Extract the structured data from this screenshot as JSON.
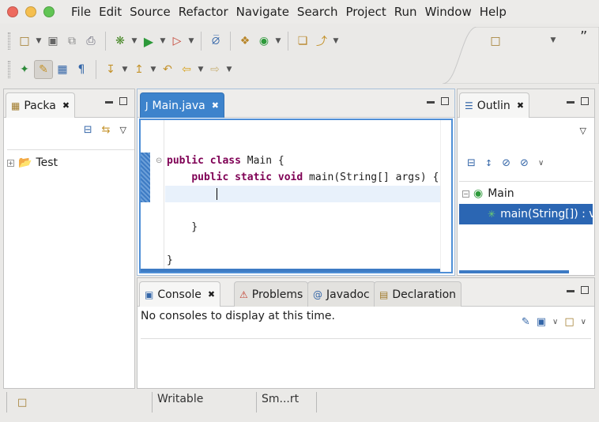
{
  "window": {
    "buttons": [
      {
        "name": "close",
        "color": "#ed6a5e"
      },
      {
        "name": "minimize",
        "color": "#f5bf4f"
      },
      {
        "name": "maximize",
        "color": "#61c554"
      }
    ]
  },
  "menu": [
    "File",
    "Edit",
    "Source",
    "Refactor",
    "Navigate",
    "Search",
    "Project",
    "Run",
    "Window",
    "Help"
  ],
  "toolbar": {
    "overflow_label": "”"
  },
  "package_explorer": {
    "tab_label": "Packa",
    "tree": [
      {
        "label": "Test",
        "expanded": false
      }
    ]
  },
  "editor": {
    "tab_label": "Main.java",
    "code": {
      "line2": {
        "kw1": "public",
        "kw2": "class",
        "rest": " Main {"
      },
      "line3": {
        "indent": "    ",
        "kw1": "public",
        "kw2": "static",
        "kw3": "void",
        "rest": " main(String[] args) {"
      },
      "line4": {
        "indent": "        "
      },
      "line6": {
        "text": "    }"
      },
      "line8": {
        "text": "}"
      }
    }
  },
  "outline": {
    "tab_label": "Outlin",
    "items": [
      {
        "label": "Main",
        "selected": false
      },
      {
        "label": "main(String[]) : v",
        "selected": true
      }
    ]
  },
  "bottom_tabs": [
    {
      "label": "Console",
      "active": true,
      "icon": "console-icon"
    },
    {
      "label": "Problems",
      "active": false,
      "icon": "problems-icon"
    },
    {
      "label": "Javadoc",
      "active": false,
      "icon": "javadoc-icon"
    },
    {
      "label": "Declaration",
      "active": false,
      "icon": "declaration-icon"
    }
  ],
  "console": {
    "message": "No consoles to display at this time."
  },
  "statusbar": {
    "writable": "Writable",
    "insert_mode": "Sm...rt"
  },
  "colors": {
    "accent": "#3d83cc",
    "selection": "#2b66b3",
    "keyword": "#7f0055"
  }
}
